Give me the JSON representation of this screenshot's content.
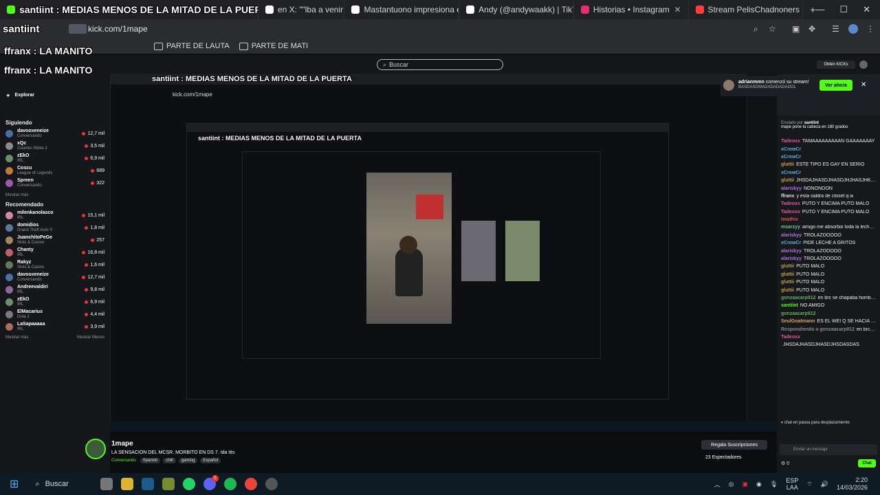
{
  "browser": {
    "tabs": [
      {
        "label": "santiint : MEDIAS MENOS DE LA MITAD DE LA PUERTA",
        "icon": "kick-icon",
        "color": "#53fc18"
      },
      {
        "label": "en X: \"\"lba a venir en",
        "icon": "x-icon",
        "color": "#ffffff"
      },
      {
        "label": "Mastantuono impresiona en el",
        "icon": "tiktok-icon",
        "color": "#ffffff"
      },
      {
        "label": "Andy (@andywaakk) | TikTok",
        "icon": "tiktok-icon",
        "color": "#ffffff"
      },
      {
        "label": "Historias • Instagram",
        "icon": "instagram-icon",
        "color": "#e1306c"
      },
      {
        "label": "Stream PelisChadnoners music",
        "icon": "youtube-icon",
        "color": "#ff3d3d"
      }
    ],
    "url": "kick.com/1mape",
    "url_overlay": "santiint",
    "bookmarks": [
      "PARTE DE LAUTA",
      "PARTE DE MATI"
    ]
  },
  "overlay": {
    "chat_lines": [
      {
        "user": "ffranx",
        "text": ": LA MANITO"
      },
      {
        "user": "ffranx",
        "text": ": LA MANITO"
      },
      {
        "user": "ffranx",
        "text": ": LA MANITO"
      },
      {
        "user": "ffranx",
        "text": ": LA MANITO"
      }
    ],
    "nested_title": "santiint : MEDIAS MENOS DE LA MITAD DE LA PUERTA",
    "nested_url": "kick.com/1mape"
  },
  "kick": {
    "search_placeholder": "Buscar",
    "get_kicks": "Obtén KICKs",
    "sidebar": {
      "explore": "Explorar",
      "following_title": "Siguiendo",
      "following": [
        {
          "name": "davooxeneize",
          "category": "Conversando",
          "viewers": "12,7 mil",
          "color": "#4a6fa5"
        },
        {
          "name": "xQc",
          "category": "Counter-Strike 2",
          "viewers": "3,5 mil",
          "color": "#8a8a8a"
        },
        {
          "name": "zEkO",
          "category": "IRL",
          "viewers": "6,9 mil",
          "color": "#6b8e6b"
        },
        {
          "name": "Coscu",
          "category": "League of Legends",
          "viewers": "689",
          "color": "#c07a3a"
        },
        {
          "name": "Spreen",
          "category": "Conversando",
          "viewers": "322",
          "color": "#9a5ab0"
        }
      ],
      "show_more": "Mostrar más",
      "recommended_title": "Recomendado",
      "recommended": [
        {
          "name": "milenkanolasco",
          "category": "IRL",
          "viewers": "15,1 mil",
          "color": "#d08aa0"
        },
        {
          "name": "domidios",
          "category": "Grand Theft Auto V",
          "viewers": "1,8 mil",
          "color": "#5a7a9a"
        },
        {
          "name": "JuanchitoPeGe",
          "category": "Slots & Casino",
          "viewers": "257",
          "color": "#a08a5a"
        },
        {
          "name": "Chanty",
          "category": "IRL",
          "viewers": "16,8 mil",
          "color": "#c0606a"
        },
        {
          "name": "Rakyz",
          "category": "Slots & Casino",
          "viewers": "1,6 mil",
          "color": "#607a5a"
        },
        {
          "name": "davooxeneize",
          "category": "Conversando",
          "viewers": "12,7 mil",
          "color": "#4a6fa5"
        },
        {
          "name": "Andreevaldiri",
          "category": "IRL",
          "viewers": "9,8 mil",
          "color": "#8a6a9a"
        },
        {
          "name": "zEkO",
          "category": "IRL",
          "viewers": "6,9 mil",
          "color": "#6b8e6b"
        },
        {
          "name": "ElMacarius",
          "category": "Dota 2",
          "viewers": "4,4 mil",
          "color": "#7a7a7a"
        },
        {
          "name": "LaSapaaaaa",
          "category": "IRL",
          "viewers": "3,9 mil",
          "color": "#b06a5a"
        }
      ],
      "show_more_bottom": "Mostrar más",
      "show_less": "Mostrar Menos"
    },
    "streamer": {
      "name": "1mape",
      "title": "LA SENSACION DEL MCSR. MORBITO EN DS 7. Ida tits",
      "category": "Conversando",
      "tags": [
        "Spanish",
        "chill",
        "gaming",
        "Español"
      ],
      "gift_subs": "Regala Suscripciones",
      "viewers_label": "23 Espectadores"
    },
    "chat": {
      "notification_user": "adrianmmn",
      "notification_text": "comenzó su stream!",
      "notification_sub": "BASDASDWADADADADADOL",
      "watch_now": "Ver ahora",
      "pinned_by": "Enviado por",
      "pinned_user": "santiint",
      "pinned_text": "mape pone la cabeza en 180 grados",
      "messages": [
        {
          "user": "Tadeoxx",
          "text": "TAMAAAAAAAAAN GAAAAAAAY",
          "color": "#e05a9a"
        },
        {
          "user": "xCrowCr",
          "text": "",
          "color": "#5ab0e0"
        },
        {
          "user": "xCrowCr",
          "text": "",
          "color": "#5ab0e0"
        },
        {
          "user": "gluttii",
          "text": "ESTE TIPO ES GAY EN SERIO",
          "color": "#c0a040"
        },
        {
          "user": "xCrowCr",
          "text": "",
          "color": "#5ab0e0"
        },
        {
          "user": "gluttii",
          "text": "JHSDAJHASDJHASDJHJHASJHKALFSKHJAGFS AGFD",
          "color": "#c0a040"
        },
        {
          "user": "alariskyy",
          "text": "NONONOON",
          "color": "#b070e0"
        },
        {
          "user": "ffranx",
          "text": "y esta saldra de ctoset q w",
          "color": "#e0e0e0"
        },
        {
          "user": "Tadeoxx",
          "text": "PUTO Y ENCIMA PUTO MALO",
          "color": "#e05a9a"
        },
        {
          "user": "Tadeoxx",
          "text": "PUTO Y ENCIMA PUTO MALO",
          "color": "#e05a9a"
        },
        {
          "user": "tmathix",
          "text": "",
          "color": "#e05050"
        },
        {
          "user": "msarzyy",
          "text": "amigo me absorbio toda la leche la fiito",
          "color": "#70c0a0"
        },
        {
          "user": "alariskyy",
          "text": "TROLAZOOOOO",
          "color": "#b070e0"
        },
        {
          "user": "xCrowCr",
          "text": "PIDE LECHE A GRITOS",
          "color": "#5ab0e0"
        },
        {
          "user": "alariskyy",
          "text": "TROLAZOOOOO",
          "color": "#b070e0"
        },
        {
          "user": "alariskyy",
          "text": "TROLAZOOOOO",
          "color": "#b070e0"
        },
        {
          "user": "gluttii",
          "text": "PUTO MALO",
          "color": "#c0a040"
        },
        {
          "user": "gluttii",
          "text": "PUTO MALO",
          "color": "#c0a040"
        },
        {
          "user": "gluttii",
          "text": "PUTO MALO",
          "color": "#c0a040"
        },
        {
          "user": "gluttii",
          "text": "PUTO MALO",
          "color": "#c0a040"
        },
        {
          "user": "gonzaacarp912",
          "text": "en brc se chapaba hombres",
          "color": "#60b060"
        },
        {
          "user": "santiint",
          "text": "NO AMIGO",
          "color": "#53fc18"
        },
        {
          "user": "gonzaacarp912",
          "text": "",
          "color": "#60b060"
        },
        {
          "user": "SeulGoatmann",
          "text": "ES EL WEI Q SE HACIA EL MALO EN EL RECREO Y DPS LO DESCUBRRAS RECIENDO POYITA POR EL ORTO",
          "color": "#e0a060"
        },
        {
          "user": "Respondiendo a gonzaacarp912",
          "text": "en brc se che...",
          "color": "#888888"
        },
        {
          "user": "Tadeoxx",
          "text": "",
          "color": "#e05a9a"
        },
        {
          "user": "",
          "text": "JHSDAJHASDJHASDJHSDASDAS",
          "color": "#e0e0e0"
        }
      ],
      "paused": "chat en pausa para desplazamiento",
      "input_placeholder": "Enviar un mensaje",
      "chat_button": "Chat",
      "count": "0"
    }
  },
  "taskbar": {
    "search": "Buscar",
    "lang": "ESP",
    "lang2": "LAA",
    "time": "2:20",
    "date": "14/03/2026",
    "discord_badge": "1"
  }
}
